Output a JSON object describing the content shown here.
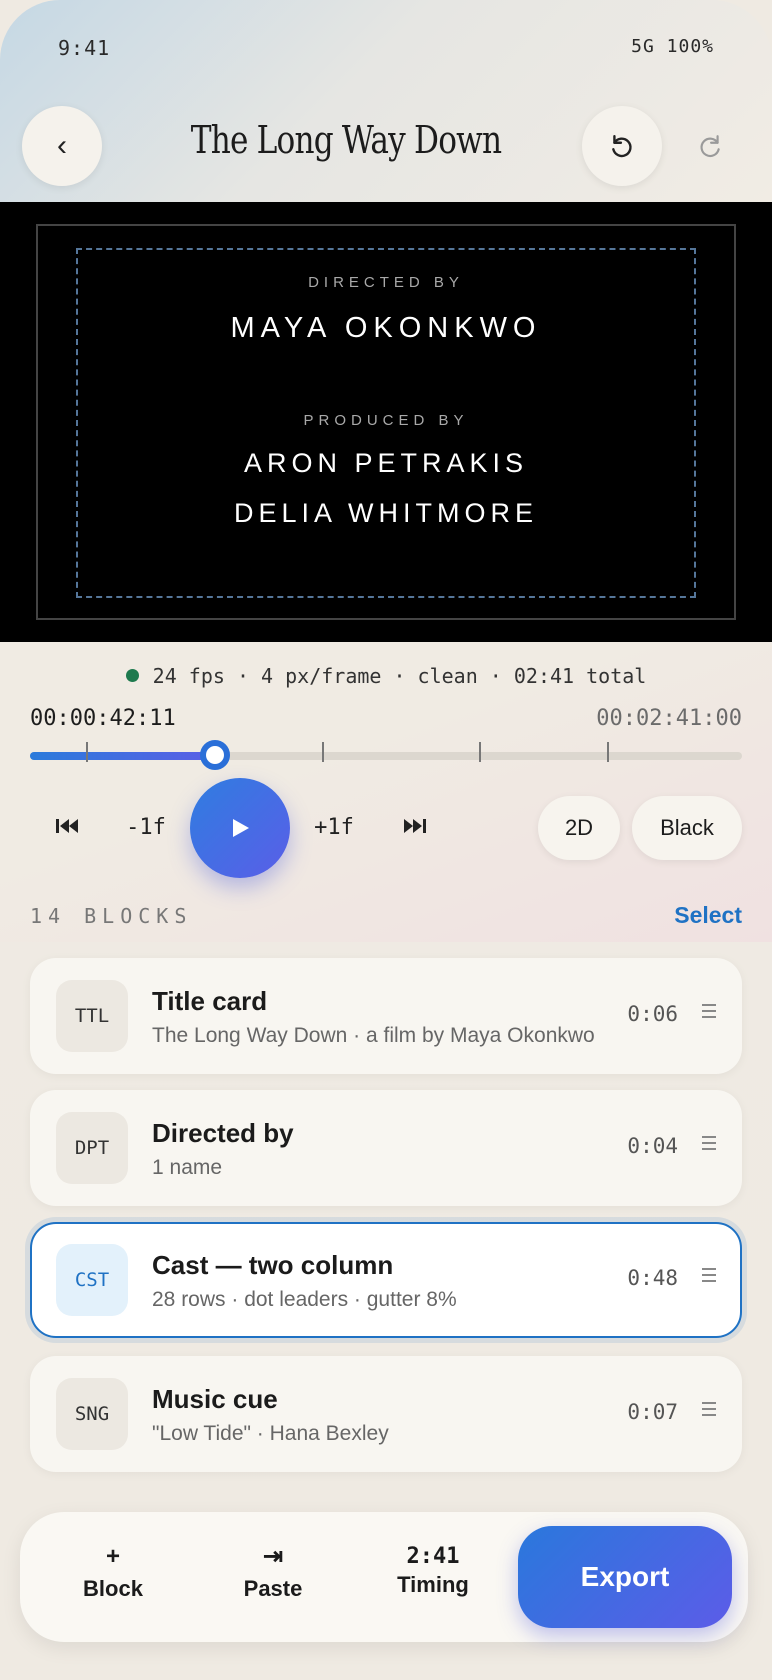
{
  "status": {
    "time": "9:41",
    "right": "5G 100%"
  },
  "header": {
    "back": "‹",
    "title": "The Long Way Down"
  },
  "preview": {
    "credits": [
      {
        "role": "DIRECTED BY",
        "names": [
          "MAYA OKONKWO"
        ]
      },
      {
        "role": "PRODUCED BY",
        "names": [
          "ARON PETRAKIS",
          "DELIA WHITMORE"
        ]
      }
    ]
  },
  "transport": {
    "meta": "24 fps · 4 px/frame · clean · 02:41 total",
    "current_tc": "00:00:42:11",
    "total_tc": "00:02:41:00",
    "progress": 0.26,
    "markers": [
      0.078,
      0.41,
      0.63,
      0.81
    ],
    "minus_frame": "-1f",
    "plus_frame": "+1f",
    "mode_label": "2D",
    "bg_label": "Black",
    "accent": "#2a6fd8"
  },
  "blocks": {
    "header": "14 BLOCKS",
    "select_label": "Select",
    "items": [
      {
        "code": "TTL",
        "title": "Title card",
        "subtitle": "The Long Way Down · a film by Maya Okonkwo",
        "duration": "0:06",
        "selected": false
      },
      {
        "code": "DPT",
        "title": "Directed by",
        "subtitle": "1 name",
        "duration": "0:04",
        "selected": false
      },
      {
        "code": "CST",
        "title": "Cast — two column",
        "subtitle": "28 rows · dot leaders · gutter 8%",
        "duration": "0:48",
        "selected": true
      },
      {
        "code": "SNG",
        "title": "Music cue",
        "subtitle": "\"Low Tide\" · Hana Bexley",
        "duration": "0:07",
        "selected": false
      }
    ]
  },
  "dock": {
    "block": {
      "icon": "+",
      "label": "Block"
    },
    "paste": {
      "icon": "⇥",
      "label": "Paste"
    },
    "timing": {
      "value": "2:41",
      "label": "Timing"
    },
    "export_label": "Export"
  }
}
